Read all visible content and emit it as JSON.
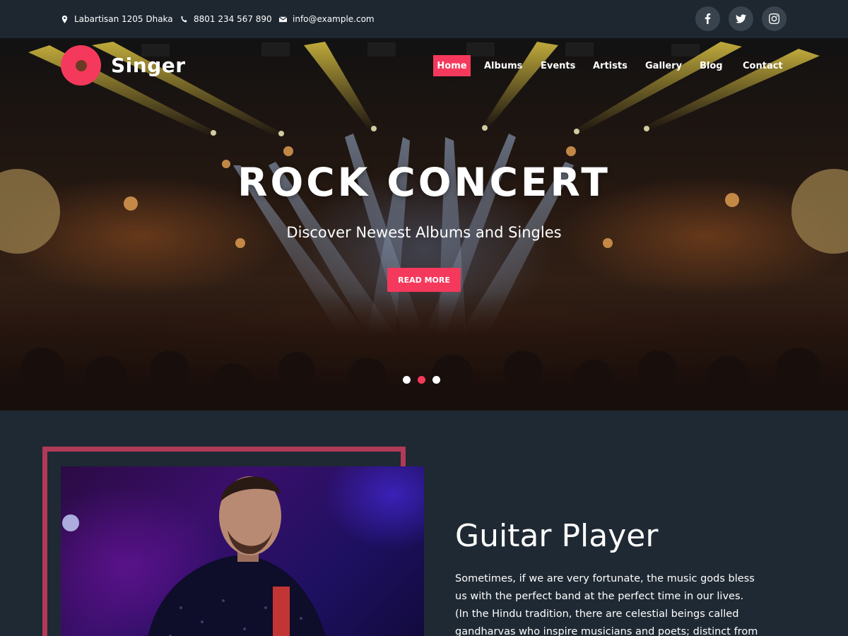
{
  "topbar": {
    "address": "Labartisan 1205 Dhaka",
    "phone": "8801 234 567 890",
    "email": "info@example.com",
    "social": [
      "facebook-icon",
      "twitter-icon",
      "instagram-icon"
    ]
  },
  "brand": {
    "name": "Singer",
    "accent_color": "#f5395c"
  },
  "nav": {
    "items": [
      {
        "label": "Home",
        "active": true
      },
      {
        "label": "Albums",
        "active": false
      },
      {
        "label": "Events",
        "active": false
      },
      {
        "label": "Artists",
        "active": false
      },
      {
        "label": "Gallery",
        "active": false
      },
      {
        "label": "Blog",
        "active": false
      },
      {
        "label": "Contact",
        "active": false
      }
    ]
  },
  "hero": {
    "title": "ROCK CONCERT",
    "subtitle": "Discover Newest Albums and Singles",
    "button_label": "READ MORE",
    "slides": 3,
    "active_slide": 2
  },
  "about": {
    "title": "Guitar Player",
    "text": "Sometimes, if we are very fortunate, the music gods bless us with the perfect band at the perfect time in our lives. (In the Hindu tradition, there are celestial beings called gandharvas who inspire musicians and poets; distinct from the Devas or angels,"
  }
}
